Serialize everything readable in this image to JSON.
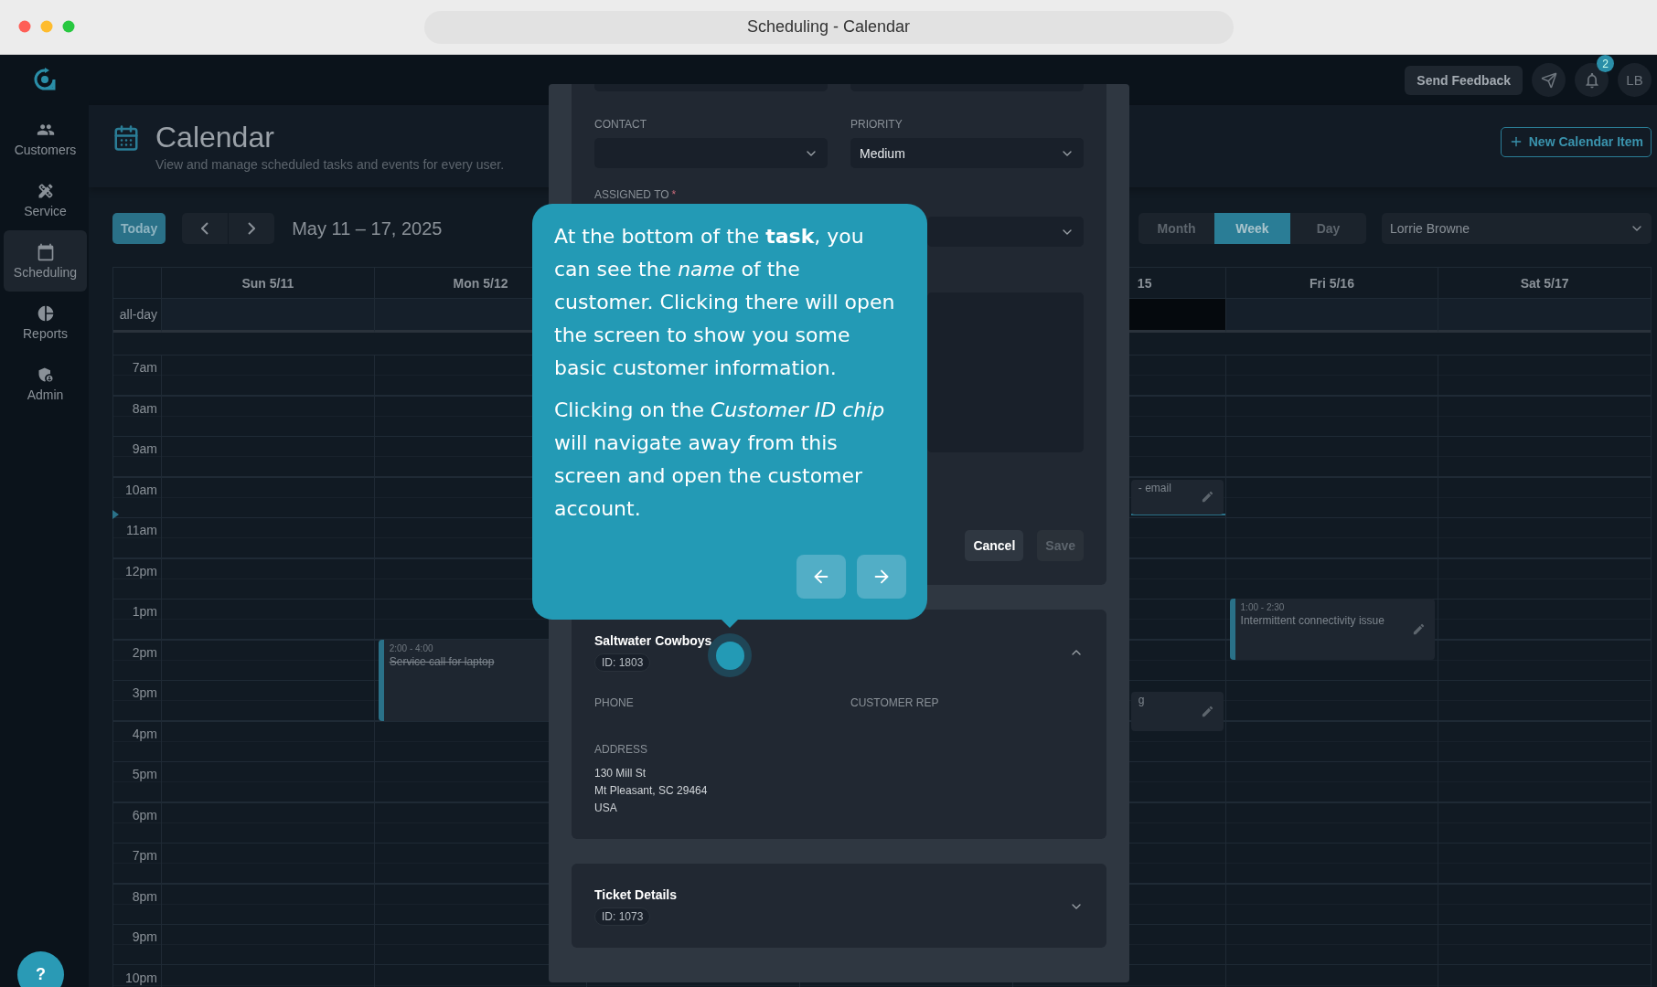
{
  "window": {
    "title": "Scheduling - Calendar"
  },
  "top_bar": {
    "feedback_button": "Send Feedback",
    "notification_count": "2",
    "avatar": "LB"
  },
  "sidebar": {
    "items": [
      {
        "label": "Customers",
        "selected": false
      },
      {
        "label": "Service",
        "selected": false
      },
      {
        "label": "Scheduling",
        "selected": true
      },
      {
        "label": "Reports",
        "selected": false
      },
      {
        "label": "Admin",
        "selected": false
      }
    ],
    "help": "?"
  },
  "header": {
    "title": "Calendar",
    "subtitle": "View and manage scheduled tasks and events for every user.",
    "new_button": "New Calendar Item"
  },
  "toolbar": {
    "today": "Today",
    "date_range": "May 11 – 17, 2025",
    "views": [
      {
        "label": "Month",
        "selected": false
      },
      {
        "label": "Week",
        "selected": true
      },
      {
        "label": "Day",
        "selected": false
      }
    ],
    "user_select": "Lorrie Browne"
  },
  "calendar": {
    "all_day_label": "all-day",
    "days": [
      {
        "label": "Sun 5/11",
        "kind": "full",
        "today": false
      },
      {
        "label": "Mon 5/12",
        "kind": "full",
        "today": false,
        "events": [
          {
            "kind": "block",
            "time": "2:00 - 4:00",
            "title": "Service call for laptop",
            "completed": true,
            "editable": false
          }
        ]
      },
      {
        "kind": "hidden"
      },
      {
        "kind": "hidden"
      },
      {
        "label": "15",
        "kind": "partial",
        "today": true,
        "events": [
          {
            "kind": "clipped",
            "title": "- email",
            "completed": false,
            "editable": true
          },
          {
            "kind": "clipped",
            "title": "g",
            "completed": false,
            "editable": true
          }
        ]
      },
      {
        "label": "Fri 5/16",
        "kind": "full",
        "today": false,
        "events": [
          {
            "kind": "block",
            "time": "1:00 - 2:30",
            "title": "Intermittent connectivity issue",
            "completed": false,
            "editable": true
          }
        ]
      },
      {
        "label": "Sat 5/17",
        "kind": "full",
        "today": false
      }
    ],
    "hours": [
      "7am",
      "8am",
      "9am",
      "10am",
      "11am",
      "12pm",
      "1pm",
      "2pm",
      "3pm",
      "4pm",
      "5pm",
      "6pm",
      "7pm",
      "8pm",
      "9pm",
      "10pm"
    ]
  },
  "modal": {
    "fields": [
      {
        "label": "CONTACT"
      },
      {
        "label": "PRIORITY",
        "value": "Medium"
      },
      {
        "label": "ASSIGNED TO",
        "required_mark": "*"
      }
    ],
    "buttons": [
      {
        "label": "Cancel",
        "disabled": false
      },
      {
        "label": "Save",
        "disabled": true
      }
    ],
    "cards": [
      {
        "title": "Saltwater Cowboys",
        "chip": "ID: 1803",
        "expanded": true,
        "details": [
          {
            "label": "PHONE"
          },
          {
            "label": "CUSTOMER REP"
          },
          {
            "label": "ADDRESS",
            "lines": [
              "130 Mill St",
              "Mt Pleasant, SC 29464",
              "USA"
            ]
          }
        ]
      },
      {
        "title": "Ticket Details",
        "chip": "ID: 1073",
        "expanded": false
      }
    ]
  },
  "tour_tooltip": {
    "paragraphs": [
      "At the bottom of the **task**, you can see the *name* of the customer. Clicking there will open the screen to show you some basic customer information.",
      "Clicking on the *Customer ID chip* will navigate away from this screen and open the customer account."
    ]
  }
}
